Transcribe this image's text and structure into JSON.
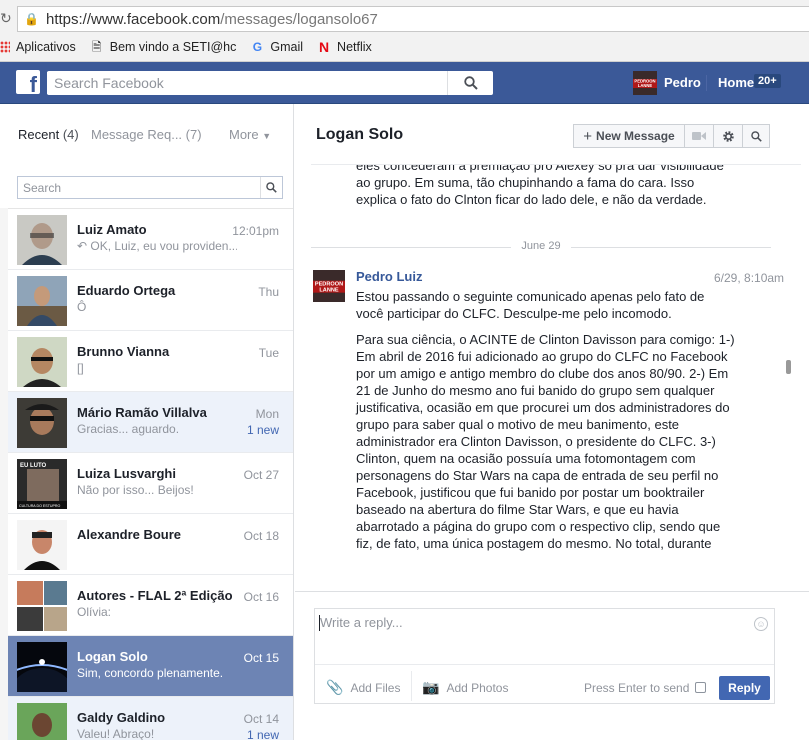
{
  "browser": {
    "url_main": "https://www.facebook.com",
    "url_path": "/messages/logansolo67",
    "bookmarks": [
      {
        "label": "Aplicativos"
      },
      {
        "label": "Bem vindo a SETI@hc"
      },
      {
        "label": "Gmail"
      },
      {
        "label": "Netflix"
      }
    ]
  },
  "fb_bar": {
    "logo": "f",
    "search_placeholder": "Search Facebook",
    "avatar_text": "PEDROON LANNE",
    "user_name": "Pedro",
    "home_label": "Home",
    "home_badge": "20+"
  },
  "left": {
    "tab_recent": "Recent",
    "tab_recent_count": "(4)",
    "tab_requests": "Message Req... (7)",
    "tab_more": "More",
    "search_placeholder": "Search",
    "threads": [
      {
        "name": "Luiz Amato",
        "snippet": "OK, Luiz, eu vou providen...",
        "time": "12:01pm",
        "new": "",
        "reply": true
      },
      {
        "name": "Eduardo Ortega",
        "snippet": "Ô",
        "time": "Thu",
        "new": ""
      },
      {
        "name": "Brunno Vianna",
        "snippet": "[]",
        "time": "Tue",
        "new": ""
      },
      {
        "name": "Mário Ramão Villalva",
        "snippet": "Gracias... aguardo.",
        "time": "Mon",
        "new": "1 new"
      },
      {
        "name": "Luiza Lusvarghi",
        "snippet": "Não por isso... Beijos!",
        "time": "Oct 27",
        "new": "",
        "avatar_text_top": "EU LUTO",
        "avatar_text_bottom": "CULTURA DO ESTUPRO"
      },
      {
        "name": "Alexandre Boure",
        "snippet": "",
        "time": "Oct 18",
        "new": ""
      },
      {
        "name": "Autores - FLAL 2ª Edição",
        "snippet": "Olívia:",
        "time": "Oct 16",
        "new": ""
      },
      {
        "name": "Logan Solo",
        "snippet": "Sim, concordo plenamente.",
        "time": "Oct 15",
        "new": ""
      },
      {
        "name": "Galdy Galdino",
        "snippet": "Valeu! Abraço!",
        "time": "Oct 14",
        "new": "1 new"
      }
    ]
  },
  "conversation": {
    "title": "Logan Solo",
    "new_message_label": "New Message",
    "prev_lines": [
      "eles concederam a premiação pro Alexey só pra dar visibilidade",
      "ao grupo. Em suma, tão chupinhando a fama do cara. Isso",
      "explica o fato do Clnton ficar do lado dele, e não da verdade."
    ],
    "date_label": "June 29",
    "sender": "Pedro Luiz",
    "sender_avatar_text": "PEDROON LANNE",
    "time": "6/29, 8:10am",
    "para1": "Estou passando o seguinte comunicado apenas pelo fato de você participar do CLFC. Desculpe-me pelo incomodo.",
    "para2": "Para sua ciência, o ACINTE de Clinton Davisson para comigo: 1-) Em abril de 2016 fui adicionado ao grupo do CLFC no Facebook por um amigo e antigo membro do clube dos anos 80/90. 2-) Em 21 de Junho do mesmo ano fui banido do grupo sem qualquer justificativa, ocasião em que procurei um dos administradores do grupo para saber qual o motivo de meu banimento, este administrador era Clinton Davisson, o presidente do CLFC. 3-) Clinton, quem na ocasião possuía uma fotomontagem com personagens do Star Wars na capa de entrada de seu perfil no Facebook, justificou que fui banido por postar um booktrailer baseado na abertura do filme Star Wars, e que eu havia abarrotado a página do grupo com o respectivo clip, sendo que fiz, de fato, uma única postagem do mesmo. No total, durante"
  },
  "composer": {
    "placeholder": "Write a reply...",
    "add_files": "Add Files",
    "add_photos": "Add Photos",
    "press_enter": "Press Enter to send",
    "reply_label": "Reply"
  }
}
